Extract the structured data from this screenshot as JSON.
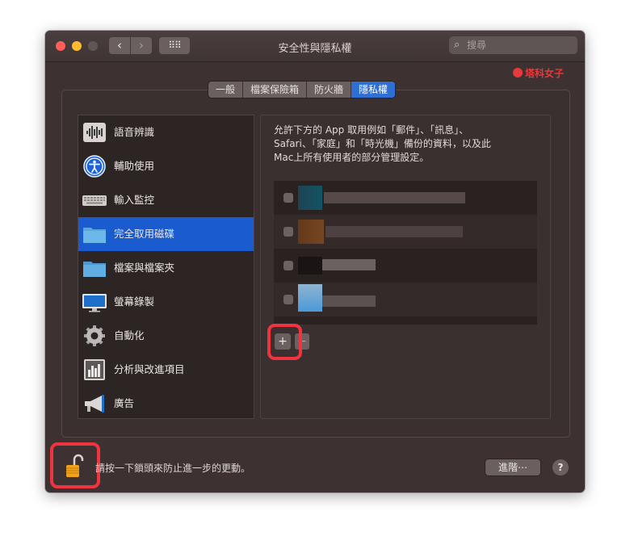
{
  "window": {
    "title": "安全性與隱私權",
    "nav": {
      "back_icon": "‹",
      "forward_icon": "›",
      "grid_icon": "⠿⠿"
    },
    "search": {
      "placeholder": "搜尋",
      "icon": "search-icon"
    }
  },
  "watermark": "塔科女子",
  "tabs": [
    {
      "label": "一般",
      "active": false
    },
    {
      "label": "檔案保險箱",
      "active": false
    },
    {
      "label": "防火牆",
      "active": false
    },
    {
      "label": "隱私權",
      "active": true
    }
  ],
  "sidebar": {
    "items": [
      {
        "label": "語音辨識",
        "icon": "waveform-icon",
        "active": false
      },
      {
        "label": "輔助使用",
        "icon": "accessibility-icon",
        "active": false
      },
      {
        "label": "輸入監控",
        "icon": "keyboard-icon",
        "active": false
      },
      {
        "label": "完全取用磁碟",
        "icon": "folder-icon",
        "active": true
      },
      {
        "label": "檔案與檔案夾",
        "icon": "folder-icon",
        "active": false
      },
      {
        "label": "螢幕錄製",
        "icon": "display-icon",
        "active": false
      },
      {
        "label": "自動化",
        "icon": "gear-icon",
        "active": false
      },
      {
        "label": "分析與改進項目",
        "icon": "chart-icon",
        "active": false
      },
      {
        "label": "廣告",
        "icon": "megaphone-icon",
        "active": false
      }
    ]
  },
  "description": {
    "line1": "允許下方的 App 取用例如「郵件」、「訊息」、",
    "line2": "Safari、「家庭」和「時光機」備份的資料，以及此",
    "line3": "Mac上所有使用者的部分管理設定。"
  },
  "app_list": {
    "rows": 4,
    "content": "blurred"
  },
  "buttons": {
    "add": "+",
    "remove": "−",
    "advanced": "進階⋯",
    "help": "?"
  },
  "footer": {
    "hint": "請按一下鎖頭來防止進一步的更動。"
  },
  "colors": {
    "accent": "#1a5ccf",
    "highlight": "#f0343f",
    "window_bg": "#3d3231"
  }
}
